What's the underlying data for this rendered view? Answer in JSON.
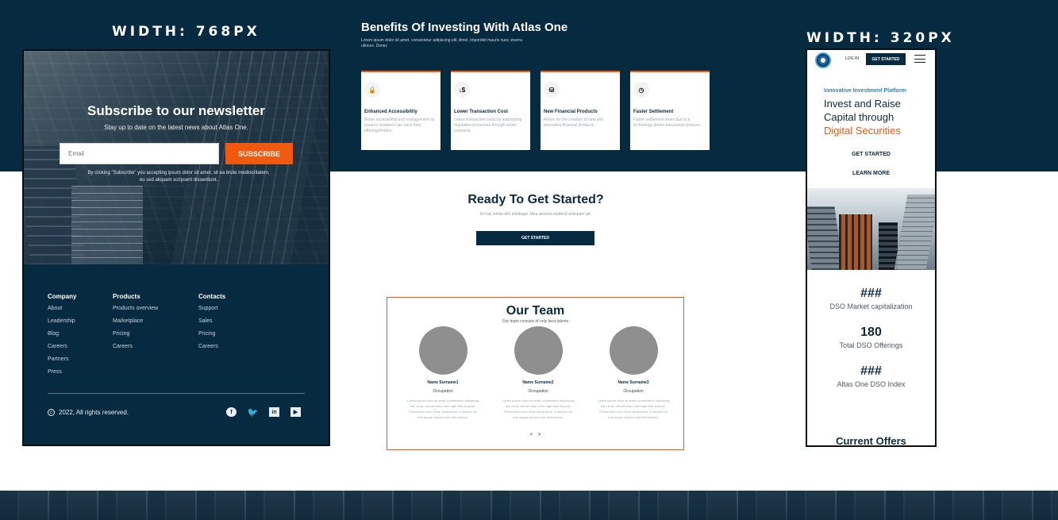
{
  "labels": {
    "tablet_width": "WIDTH: 768PX",
    "mobile_width": "WIDTH: 320PX"
  },
  "tablet": {
    "newsletter": {
      "title": "Subscribe to our newsletter",
      "subtitle": "Stay up to date on the latest news about Atlas One.",
      "email_placeholder": "Email",
      "button": "SUBSCRIBE",
      "disclaimer": "By clicking \"Subscribe\" you accepting ipsum dolor sit amet, sit ea brute mediocritatem, eu sed aliquam scripserit dissentiunt."
    },
    "footer": {
      "columns": [
        {
          "title": "Company",
          "links": [
            "About",
            "Leadership",
            "Blog",
            "Careers",
            "Partners",
            "Press"
          ]
        },
        {
          "title": "Products",
          "links": [
            "Products overview",
            "Marketplace",
            "Pricing",
            "Careers"
          ]
        },
        {
          "title": "Contacts",
          "links": [
            "Support",
            "Sales",
            "Pricing",
            "Careers"
          ]
        }
      ],
      "copyright": "2022, All rights reserved.",
      "socials": [
        "facebook-icon",
        "twitter-icon",
        "linkedin-icon",
        "youtube-icon"
      ]
    }
  },
  "benefits": {
    "title": "Benefits Of Investing With Atlas One",
    "description": "Lorem ipsum dolor sit amet, consectetur adipiscing elit. Amet, imperdiet mauris nunc viverra ultrices. Donec",
    "cards": [
      {
        "icon": "lock-icon",
        "glyph": "🔒",
        "title": "Enhanced Accessibility",
        "text": "Better accessibility and management as issuers/ investors can track their offerings/trades."
      },
      {
        "icon": "dollar-arrows-icon",
        "glyph": "↓$",
        "title": "Lower Transaction Cost",
        "text": "Lower transaction costs by automating regulation processes through smart contracts."
      },
      {
        "icon": "coins-icon",
        "glyph": "⛁",
        "title": "New Financial Products",
        "text": "Allows for the creation of new and innovative financial products."
      },
      {
        "icon": "clock-icon",
        "glyph": "◷",
        "title": "Faster Settlement",
        "text": "Faster settlement times due to a technology driven transaction process."
      }
    ]
  },
  "ready": {
    "title": "Ready To Get Started?",
    "subtitle": "Et has minim elitr intellegat. Mea aeterno eleifend antiopam ad.",
    "button": "GET STARTED"
  },
  "team": {
    "title": "Our Team",
    "subtitle": "Our team consists of only best talents",
    "members": [
      {
        "name": "Name Surname1",
        "role": "Occupation",
        "bio": "Lorem ipsum dolor sit amet, consectetur adipiscing elit. Urna, ultrices diam nibh eget felis tempus. Fermentum nunc vitae volutpat elit. A ultrices dui erat augue sapien nunc elementum."
      },
      {
        "name": "Name Surname2",
        "role": "Occupation",
        "bio": "Lorem ipsum dolor sit amet, consectetur adipiscing elit. Urna, ultrices diam nibh eget felis tempus. Fermentum nunc vitae volutpat elit. A ultrices dui erat augue sapien nunc elementum."
      },
      {
        "name": "Name Surname3",
        "role": "Occupation",
        "bio": "Lorem ipsum dolor sit amet, consectetur adipiscing elit. Urna, ultrices diam nibh eget felis tempus. Fermentum nunc vitae volutpat elit. A ultrices dui erat augue sapien nunc elementum."
      }
    ],
    "prev": "<",
    "next": ">"
  },
  "mobile": {
    "login": "LOG IN",
    "get_started": "GET STARTED",
    "eyebrow": "Innovative Investment Platform",
    "headline_1": "Invest and Raise",
    "headline_2": "Capital through",
    "headline_highlight": "Digital Securities",
    "link_get_started": "GET STARTED",
    "link_learn_more": "LEARN MORE",
    "stats": [
      {
        "value": "###",
        "label": "DSO Market capitalization"
      },
      {
        "value": "180",
        "label": "Total DSO Offerings"
      },
      {
        "value": "###",
        "label": "Altas One DSO Index"
      }
    ],
    "offers_title": "Current Offers"
  },
  "colors": {
    "navy": "#062a40",
    "accent": "#f15a0e",
    "link_blue": "#2b86b8"
  }
}
